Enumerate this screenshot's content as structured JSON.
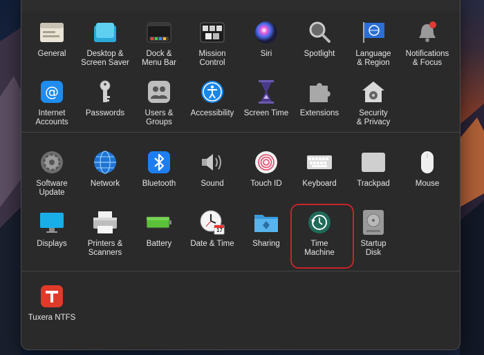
{
  "window": {
    "accent_color": "#d83a3a",
    "highlight_color": "#c8232a"
  },
  "sections": {
    "personal": [
      {
        "label": "General",
        "icon": "general-icon"
      },
      {
        "label": "Desktop &\nScreen Saver",
        "icon": "desktop-icon"
      },
      {
        "label": "Dock &\nMenu Bar",
        "icon": "dock-icon"
      },
      {
        "label": "Mission\nControl",
        "icon": "mission-control-icon"
      },
      {
        "label": "Siri",
        "icon": "siri-icon"
      },
      {
        "label": "Spotlight",
        "icon": "spotlight-icon"
      },
      {
        "label": "Language\n& Region",
        "icon": "language-icon"
      },
      {
        "label": "Notifications\n& Focus",
        "icon": "notifications-icon"
      },
      {
        "label": "Internet\nAccounts",
        "icon": "internet-accounts-icon"
      },
      {
        "label": "Passwords",
        "icon": "key-icon"
      },
      {
        "label": "Users &\nGroups",
        "icon": "users-icon"
      },
      {
        "label": "Accessibility",
        "icon": "accessibility-icon"
      },
      {
        "label": "Screen Time",
        "icon": "hourglass-icon"
      },
      {
        "label": "Extensions",
        "icon": "puzzle-icon"
      },
      {
        "label": "Security\n& Privacy",
        "icon": "security-icon"
      }
    ],
    "hardware": [
      {
        "label": "Software\nUpdate",
        "icon": "gear-icon"
      },
      {
        "label": "Network",
        "icon": "globe-icon"
      },
      {
        "label": "Bluetooth",
        "icon": "bluetooth-icon"
      },
      {
        "label": "Sound",
        "icon": "speaker-icon"
      },
      {
        "label": "Touch ID",
        "icon": "fingerprint-icon"
      },
      {
        "label": "Keyboard",
        "icon": "keyboard-icon"
      },
      {
        "label": "Trackpad",
        "icon": "trackpad-icon"
      },
      {
        "label": "Mouse",
        "icon": "mouse-icon"
      },
      {
        "label": "Displays",
        "icon": "display-icon"
      },
      {
        "label": "Printers &\nScanners",
        "icon": "printer-icon"
      },
      {
        "label": "Battery",
        "icon": "battery-icon"
      },
      {
        "label": "Date & Time",
        "icon": "clock-icon"
      },
      {
        "label": "Sharing",
        "icon": "folder-icon"
      },
      {
        "label": "Time\nMachine",
        "icon": "time-machine-icon"
      },
      {
        "label": "Startup\nDisk",
        "icon": "disk-icon"
      }
    ],
    "other": [
      {
        "label": "Tuxera NTFS",
        "icon": "tuxera-icon"
      }
    ]
  },
  "date_time_badge": "17"
}
